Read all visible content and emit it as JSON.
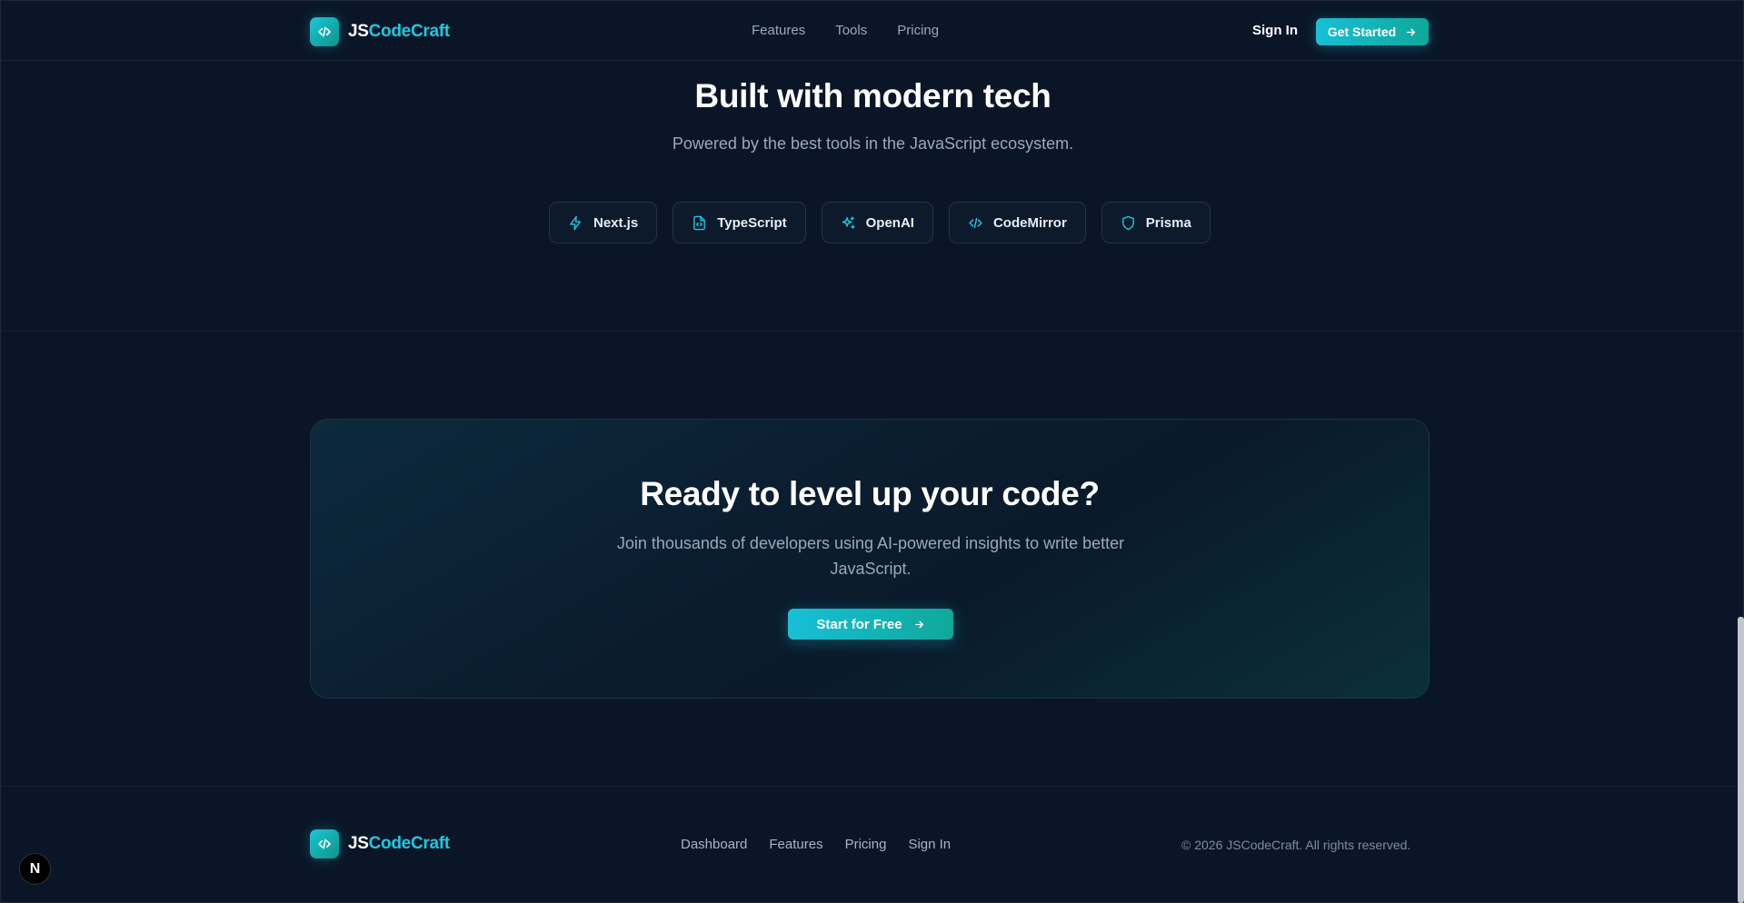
{
  "header": {
    "brand": {
      "part1": "JS",
      "part2": "CodeCraft",
      "logo_icon": "code-icon"
    },
    "nav": [
      "Features",
      "Tools",
      "Pricing"
    ],
    "signin_label": "Sign In",
    "get_started_label": "Get Started"
  },
  "tech": {
    "title": "Built with modern tech",
    "subtitle": "Powered by the best tools in the JavaScript ecosystem.",
    "chips": [
      {
        "label": "Next.js",
        "icon": "lightning-icon"
      },
      {
        "label": "TypeScript",
        "icon": "file-code-icon"
      },
      {
        "label": "OpenAI",
        "icon": "sparkles-icon"
      },
      {
        "label": "CodeMirror",
        "icon": "code-icon"
      },
      {
        "label": "Prisma",
        "icon": "shield-icon"
      }
    ]
  },
  "cta": {
    "title": "Ready to level up your code?",
    "subtitle": "Join thousands of developers using AI-powered insights to write better JavaScript.",
    "button_label": "Start for Free"
  },
  "footer": {
    "brand": {
      "part1": "JS",
      "part2": "CodeCraft"
    },
    "links": [
      "Dashboard",
      "Features",
      "Pricing",
      "Sign In"
    ],
    "copyright": "© 2026 JSCodeCraft. All rights reserved."
  },
  "dev_badge": "N",
  "colors": {
    "accent": "#1ec8e0",
    "accent2": "#0fa89a",
    "background": "#0a1628"
  }
}
